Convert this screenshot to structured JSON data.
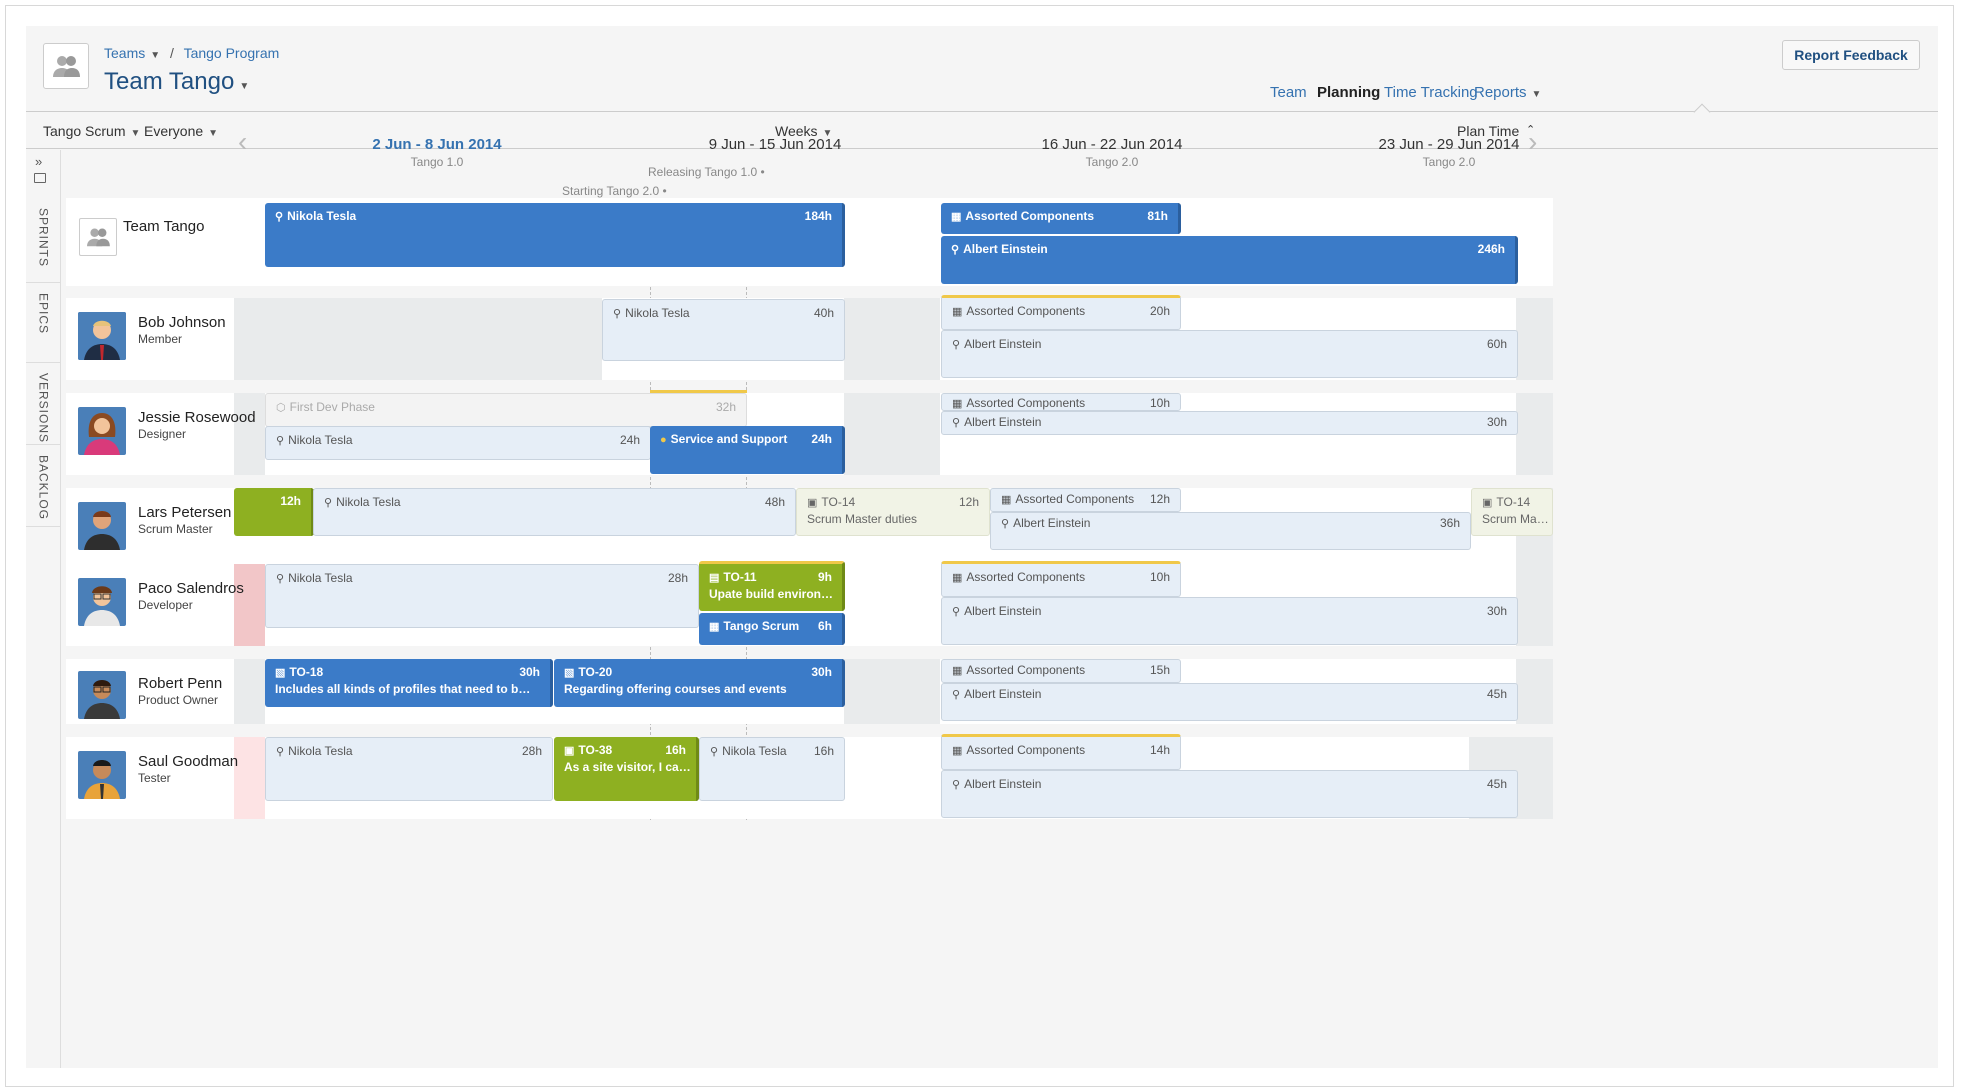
{
  "header": {
    "breadcrumb": {
      "teams": "Teams",
      "program": "Tango Program"
    },
    "title": "Team Tango",
    "feedback_button": "Report Feedback",
    "nav": [
      "Team",
      "Planning",
      "Time Tracking",
      "Reports"
    ]
  },
  "toolbar": {
    "board": "Tango Scrum",
    "filter": "Everyone",
    "scale": "Weeks",
    "plan_time": "Plan Time"
  },
  "sidebar": {
    "expand": "»",
    "tabs": [
      "SPRINTS",
      "EPICS",
      "VERSIONS",
      "BACKLOG"
    ]
  },
  "weeks": [
    {
      "date": "2 Jun - 8 Jun 2014",
      "sprint": "Tango 1.0"
    },
    {
      "date": "9 Jun - 15 Jun 2014",
      "sprint": ""
    },
    {
      "date": "16 Jun - 22 Jun 2014",
      "sprint": "Tango 2.0"
    },
    {
      "date": "23 Jun - 29 Jun 2014",
      "sprint": "Tango 2.0"
    }
  ],
  "milestones": {
    "release": "Releasing Tango 1.0",
    "start": "Starting Tango 2.0"
  },
  "rows": [
    {
      "name": "Team Tango",
      "role": ""
    },
    {
      "name": "Bob Johnson",
      "role": "Member"
    },
    {
      "name": "Jessie Rosewood",
      "role": "Designer"
    },
    {
      "name": "Lars Petersen",
      "role": "Scrum Master"
    },
    {
      "name": "Paco Salendros",
      "role": "Developer"
    },
    {
      "name": "Robert Penn",
      "role": "Product Owner"
    },
    {
      "name": "Saul Goodman",
      "role": "Tester"
    }
  ],
  "bars": {
    "team_nikola": {
      "label": "Nikola Tesla",
      "hours": "184h"
    },
    "team_assorted": {
      "label": "Assorted Components",
      "hours": "81h"
    },
    "team_albert": {
      "label": "Albert Einstein",
      "hours": "246h"
    },
    "bob_nikola": {
      "label": "Nikola Tesla",
      "hours": "40h"
    },
    "bob_assorted": {
      "label": "Assorted Components",
      "hours": "20h"
    },
    "bob_albert": {
      "label": "Albert Einstein",
      "hours": "60h"
    },
    "jes_firstdev": {
      "label": "First Dev Phase",
      "hours": "32h"
    },
    "jes_nikola": {
      "label": "Nikola Tesla",
      "hours": "24h"
    },
    "jes_service": {
      "label": "Service and Support",
      "hours": "24h"
    },
    "jes_assorted": {
      "label": "Assorted Components",
      "hours": "10h"
    },
    "jes_albert": {
      "label": "Albert Einstein",
      "hours": "30h"
    },
    "lars_green": {
      "hours": "12h"
    },
    "lars_nikola": {
      "label": "Nikola Tesla",
      "hours": "48h"
    },
    "lars_to14": {
      "label": "TO-14",
      "sub": "Scrum Master duties",
      "hours": "12h"
    },
    "lars_assorted": {
      "label": "Assorted Components",
      "hours": "12h"
    },
    "lars_albert": {
      "label": "Albert Einstein",
      "hours": "36h"
    },
    "lars_to14b": {
      "label": "TO-14",
      "sub": "Scrum Master du"
    },
    "paco_nikola": {
      "label": "Nikola Tesla",
      "hours": "28h"
    },
    "paco_to11": {
      "label": "TO-11",
      "sub": "Upate build environment ...",
      "hours": "9h"
    },
    "paco_scrum": {
      "label": "Tango Scrum",
      "hours": "6h"
    },
    "paco_assorted": {
      "label": "Assorted Components",
      "hours": "10h"
    },
    "paco_albert": {
      "label": "Albert Einstein",
      "hours": "30h"
    },
    "rob_to18": {
      "label": "TO-18",
      "sub": "Includes all kinds of profiles that need to be created",
      "hours": "30h"
    },
    "rob_to20": {
      "label": "TO-20",
      "sub": "Regarding offering courses and events",
      "hours": "30h"
    },
    "rob_assorted": {
      "label": "Assorted Components",
      "hours": "15h"
    },
    "rob_albert": {
      "label": "Albert Einstein",
      "hours": "45h"
    },
    "saul_nikola": {
      "label": "Nikola Tesla",
      "hours": "28h"
    },
    "saul_to38": {
      "label": "TO-38",
      "sub": "As a site visitor, I can em...",
      "hours": "16h"
    },
    "saul_nikola2": {
      "label": "Nikola Tesla",
      "hours": "16h"
    },
    "saul_assorted": {
      "label": "Assorted Components",
      "hours": "14h"
    },
    "saul_albert": {
      "label": "Albert Einstein",
      "hours": "45h"
    }
  },
  "icons": {
    "user": "user-icon",
    "component": "component-icon",
    "issue": "issue-icon"
  }
}
